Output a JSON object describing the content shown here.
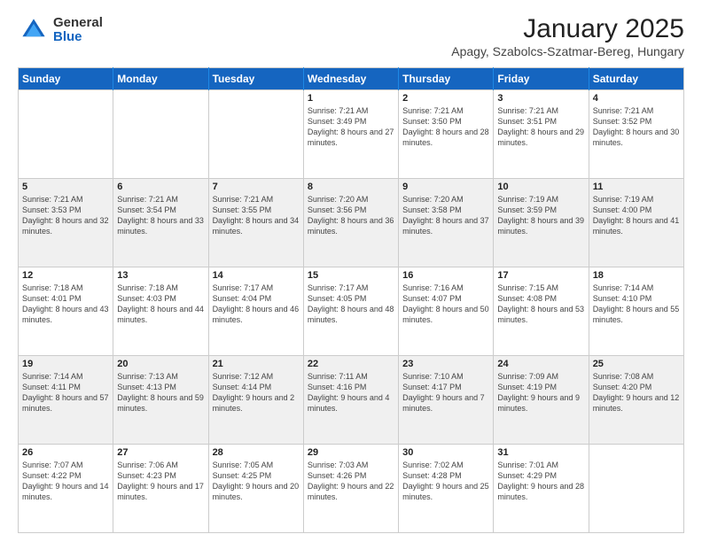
{
  "header": {
    "logo": {
      "general": "General",
      "blue": "Blue"
    },
    "title": "January 2025",
    "subtitle": "Apagy, Szabolcs-Szatmar-Bereg, Hungary"
  },
  "weekdays": [
    "Sunday",
    "Monday",
    "Tuesday",
    "Wednesday",
    "Thursday",
    "Friday",
    "Saturday"
  ],
  "weeks": [
    [
      {
        "day": "",
        "info": ""
      },
      {
        "day": "",
        "info": ""
      },
      {
        "day": "",
        "info": ""
      },
      {
        "day": "1",
        "info": "Sunrise: 7:21 AM\nSunset: 3:49 PM\nDaylight: 8 hours and 27 minutes."
      },
      {
        "day": "2",
        "info": "Sunrise: 7:21 AM\nSunset: 3:50 PM\nDaylight: 8 hours and 28 minutes."
      },
      {
        "day": "3",
        "info": "Sunrise: 7:21 AM\nSunset: 3:51 PM\nDaylight: 8 hours and 29 minutes."
      },
      {
        "day": "4",
        "info": "Sunrise: 7:21 AM\nSunset: 3:52 PM\nDaylight: 8 hours and 30 minutes."
      }
    ],
    [
      {
        "day": "5",
        "info": "Sunrise: 7:21 AM\nSunset: 3:53 PM\nDaylight: 8 hours and 32 minutes."
      },
      {
        "day": "6",
        "info": "Sunrise: 7:21 AM\nSunset: 3:54 PM\nDaylight: 8 hours and 33 minutes."
      },
      {
        "day": "7",
        "info": "Sunrise: 7:21 AM\nSunset: 3:55 PM\nDaylight: 8 hours and 34 minutes."
      },
      {
        "day": "8",
        "info": "Sunrise: 7:20 AM\nSunset: 3:56 PM\nDaylight: 8 hours and 36 minutes."
      },
      {
        "day": "9",
        "info": "Sunrise: 7:20 AM\nSunset: 3:58 PM\nDaylight: 8 hours and 37 minutes."
      },
      {
        "day": "10",
        "info": "Sunrise: 7:19 AM\nSunset: 3:59 PM\nDaylight: 8 hours and 39 minutes."
      },
      {
        "day": "11",
        "info": "Sunrise: 7:19 AM\nSunset: 4:00 PM\nDaylight: 8 hours and 41 minutes."
      }
    ],
    [
      {
        "day": "12",
        "info": "Sunrise: 7:18 AM\nSunset: 4:01 PM\nDaylight: 8 hours and 43 minutes."
      },
      {
        "day": "13",
        "info": "Sunrise: 7:18 AM\nSunset: 4:03 PM\nDaylight: 8 hours and 44 minutes."
      },
      {
        "day": "14",
        "info": "Sunrise: 7:17 AM\nSunset: 4:04 PM\nDaylight: 8 hours and 46 minutes."
      },
      {
        "day": "15",
        "info": "Sunrise: 7:17 AM\nSunset: 4:05 PM\nDaylight: 8 hours and 48 minutes."
      },
      {
        "day": "16",
        "info": "Sunrise: 7:16 AM\nSunset: 4:07 PM\nDaylight: 8 hours and 50 minutes."
      },
      {
        "day": "17",
        "info": "Sunrise: 7:15 AM\nSunset: 4:08 PM\nDaylight: 8 hours and 53 minutes."
      },
      {
        "day": "18",
        "info": "Sunrise: 7:14 AM\nSunset: 4:10 PM\nDaylight: 8 hours and 55 minutes."
      }
    ],
    [
      {
        "day": "19",
        "info": "Sunrise: 7:14 AM\nSunset: 4:11 PM\nDaylight: 8 hours and 57 minutes."
      },
      {
        "day": "20",
        "info": "Sunrise: 7:13 AM\nSunset: 4:13 PM\nDaylight: 8 hours and 59 minutes."
      },
      {
        "day": "21",
        "info": "Sunrise: 7:12 AM\nSunset: 4:14 PM\nDaylight: 9 hours and 2 minutes."
      },
      {
        "day": "22",
        "info": "Sunrise: 7:11 AM\nSunset: 4:16 PM\nDaylight: 9 hours and 4 minutes."
      },
      {
        "day": "23",
        "info": "Sunrise: 7:10 AM\nSunset: 4:17 PM\nDaylight: 9 hours and 7 minutes."
      },
      {
        "day": "24",
        "info": "Sunrise: 7:09 AM\nSunset: 4:19 PM\nDaylight: 9 hours and 9 minutes."
      },
      {
        "day": "25",
        "info": "Sunrise: 7:08 AM\nSunset: 4:20 PM\nDaylight: 9 hours and 12 minutes."
      }
    ],
    [
      {
        "day": "26",
        "info": "Sunrise: 7:07 AM\nSunset: 4:22 PM\nDaylight: 9 hours and 14 minutes."
      },
      {
        "day": "27",
        "info": "Sunrise: 7:06 AM\nSunset: 4:23 PM\nDaylight: 9 hours and 17 minutes."
      },
      {
        "day": "28",
        "info": "Sunrise: 7:05 AM\nSunset: 4:25 PM\nDaylight: 9 hours and 20 minutes."
      },
      {
        "day": "29",
        "info": "Sunrise: 7:03 AM\nSunset: 4:26 PM\nDaylight: 9 hours and 22 minutes."
      },
      {
        "day": "30",
        "info": "Sunrise: 7:02 AM\nSunset: 4:28 PM\nDaylight: 9 hours and 25 minutes."
      },
      {
        "day": "31",
        "info": "Sunrise: 7:01 AM\nSunset: 4:29 PM\nDaylight: 9 hours and 28 minutes."
      },
      {
        "day": "",
        "info": ""
      }
    ]
  ],
  "row_shades": [
    "row-white",
    "row-shade",
    "row-white",
    "row-shade",
    "row-white"
  ]
}
